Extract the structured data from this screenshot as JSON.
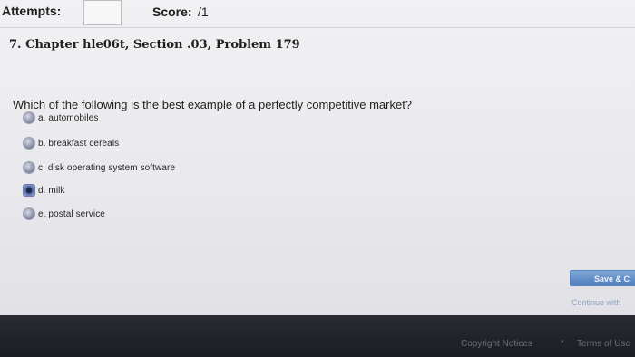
{
  "header": {
    "attempts_label": "Attempts:",
    "score_label": "Score:",
    "score_value": "/1"
  },
  "problem": {
    "title": "7. Chapter hle06t, Section .03, Problem 179",
    "question": "Which of the following is the best example of a perfectly competitive market?",
    "options": [
      {
        "label": "a. automobiles",
        "selected": false
      },
      {
        "label": "b. breakfast cereals",
        "selected": false
      },
      {
        "label": "c. disk operating system software",
        "selected": false
      },
      {
        "label": "d. milk",
        "selected": true
      },
      {
        "label": "e. postal service",
        "selected": false
      }
    ]
  },
  "actions": {
    "save_label": "Save & C",
    "continue_label": "Continue with"
  },
  "footer": {
    "copyright_label": "Copyright Notices",
    "terms_label": "Terms of Use"
  }
}
